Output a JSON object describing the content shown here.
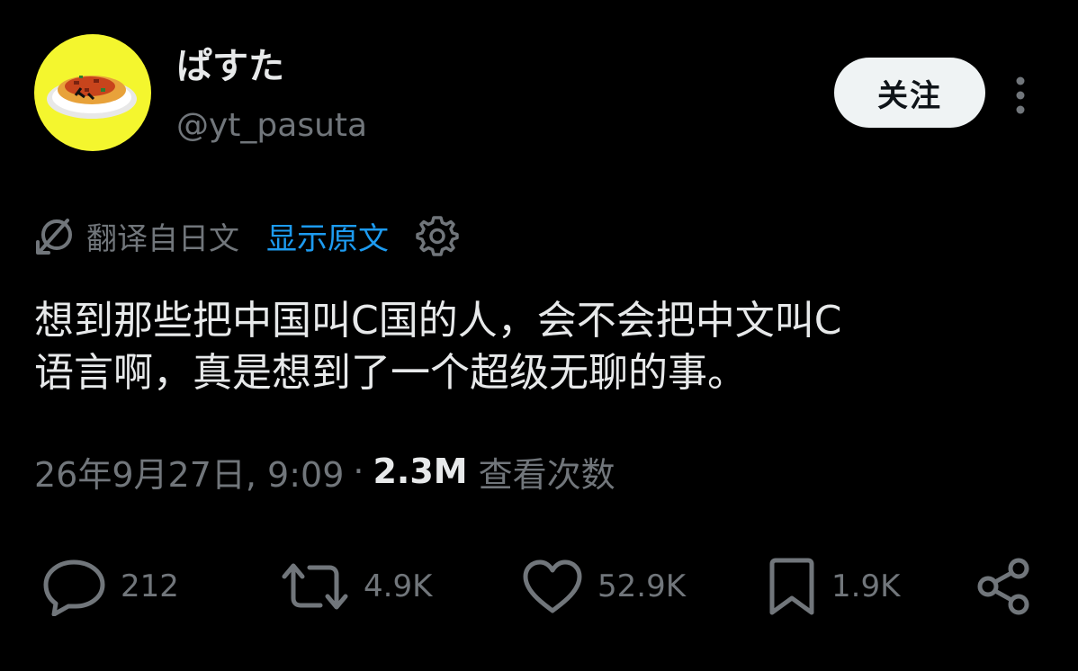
{
  "author": {
    "display_name": "ぱすた",
    "handle": "@yt_pasuta",
    "avatar_icon": "pasta-plate-icon",
    "avatar_bg": "#f4f62e"
  },
  "follow_button": {
    "label": "关注"
  },
  "more_icon": "more-vertical-icon",
  "translation": {
    "icon": "translate-icon",
    "label": "翻译自日文",
    "show_original": "显示原文",
    "settings_icon": "gear-icon"
  },
  "tweet": {
    "lines": [
      "想到那些把中国叫C国的人，会不会把中文叫C",
      "语言啊，真是想到了一个超级无聊的事。"
    ]
  },
  "meta": {
    "timestamp": "26年9月27日, 9:09",
    "separator": "·",
    "views_count": "2.3M",
    "views_label": "查看次数"
  },
  "actions": {
    "reply": {
      "icon": "reply-icon",
      "count": "212"
    },
    "repost": {
      "icon": "repost-icon",
      "count": "4.9K"
    },
    "like": {
      "icon": "heart-icon",
      "count": "52.9K"
    },
    "bookmark": {
      "icon": "bookmark-icon",
      "count": "1.9K"
    },
    "share": {
      "icon": "share-icon"
    }
  },
  "colors": {
    "background": "#000000",
    "primary_text": "#e7e9ea",
    "secondary_text": "#71767b",
    "link": "#1d9bf0",
    "button_bg": "#eff3f4"
  }
}
